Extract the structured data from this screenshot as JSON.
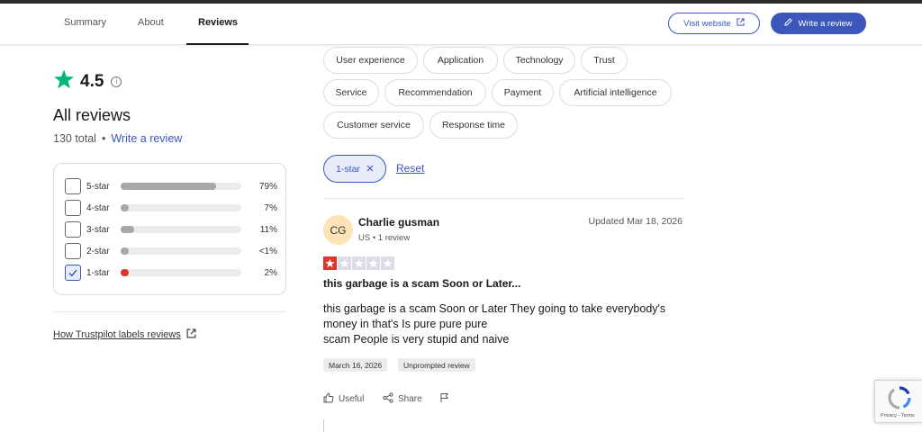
{
  "nav": {
    "tabs": [
      "Summary",
      "About",
      "Reviews"
    ],
    "active_tab": "Reviews",
    "visit_website": "Visit website",
    "write_review": "Write a review"
  },
  "summary": {
    "rating": "4.5",
    "heading": "All reviews",
    "total": "130 total",
    "separator": "•",
    "write_review_link": "Write a review"
  },
  "star_filters": [
    {
      "label": "5-star",
      "percent": "79%",
      "fill": 79,
      "checked": false
    },
    {
      "label": "4-star",
      "percent": "7%",
      "fill": 7,
      "checked": false
    },
    {
      "label": "3-star",
      "percent": "11%",
      "fill": 11,
      "checked": false
    },
    {
      "label": "2-star",
      "percent": "<1%",
      "fill": 1,
      "checked": false
    },
    {
      "label": "1-star",
      "percent": "2%",
      "fill": 2,
      "checked": true
    }
  ],
  "how_link": "How Trustpilot labels reviews",
  "topic_chips": [
    "User experience",
    "Application",
    "Technology",
    "Trust",
    "Service",
    "Recommendation",
    "Payment",
    "Artificial intelligence",
    "Customer service",
    "Response time"
  ],
  "active_filter": {
    "label": "1-star",
    "reset": "Reset"
  },
  "review": {
    "initials": "CG",
    "name": "Charlie gusman",
    "meta": "US • 1 review",
    "updated": "Updated Mar 18, 2026",
    "stars": 1,
    "title": "this garbage is a scam Soon or Later...",
    "body_line1": "this garbage is a scam Soon or Later They going to take everybody's",
    "body_line2": "money in that's Is pure pure pure",
    "body_line3": "scam People is very stupid and naive",
    "date_tag": "March 16, 2026",
    "type_tag": "Unprompted review",
    "useful": "Useful",
    "share": "Share"
  },
  "recaptcha": {
    "text": "Privacy - Terms"
  },
  "colors": {
    "accent": "#3c57bc",
    "star_green": "#00b67a",
    "star_red": "#e0352b"
  }
}
